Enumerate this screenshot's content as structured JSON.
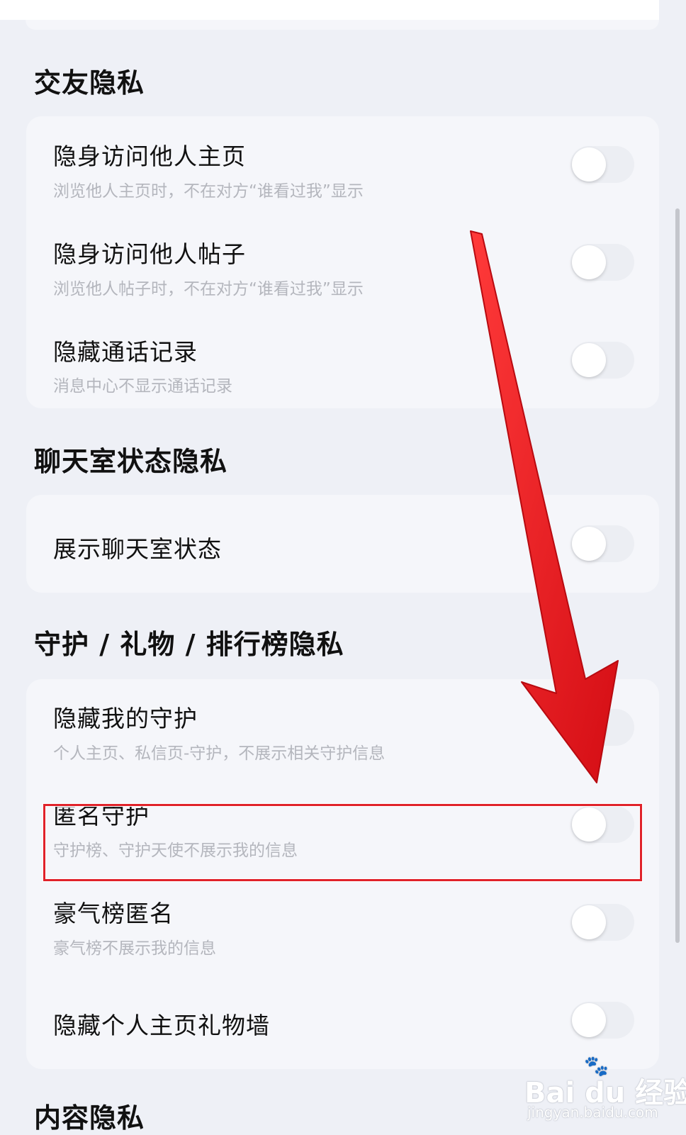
{
  "sections": [
    {
      "title": "交友隐私",
      "items": [
        {
          "title": "隐身访问他人主页",
          "subtitle": "浏览他人主页时，不在对方“谁看过我”显示",
          "on": false
        },
        {
          "title": "隐身访问他人帖子",
          "subtitle": "浏览他人帖子时，不在对方“谁看过我”显示",
          "on": false
        },
        {
          "title": "隐藏通话记录",
          "subtitle": "消息中心不显示通话记录",
          "on": false
        }
      ]
    },
    {
      "title": "聊天室状态隐私",
      "items": [
        {
          "title": "展示聊天室状态",
          "subtitle": "",
          "on": false
        }
      ]
    },
    {
      "title": "守护 / 礼物 / 排行榜隐私",
      "items": [
        {
          "title": "隐藏我的守护",
          "subtitle": "个人主页、私信页-守护，不展示相关守护信息",
          "on": false
        },
        {
          "title": "匿名守护",
          "subtitle": "守护榜、守护天使不展示我的信息",
          "on": false
        },
        {
          "title": "豪气榜匿名",
          "subtitle": "豪气榜不展示我的信息",
          "on": false
        },
        {
          "title": "隐藏个人主页礼物墙",
          "subtitle": "",
          "on": false
        }
      ]
    },
    {
      "title": "内容隐私",
      "items": []
    }
  ],
  "annotation": {
    "highlighted_item": "匿名守护",
    "arrow_color": "#e8181f",
    "box_color": "#e0222a"
  },
  "watermark": {
    "main": "Bai du 经验",
    "sub": "jingyan.baidu.com",
    "icon": "paw-icon"
  }
}
